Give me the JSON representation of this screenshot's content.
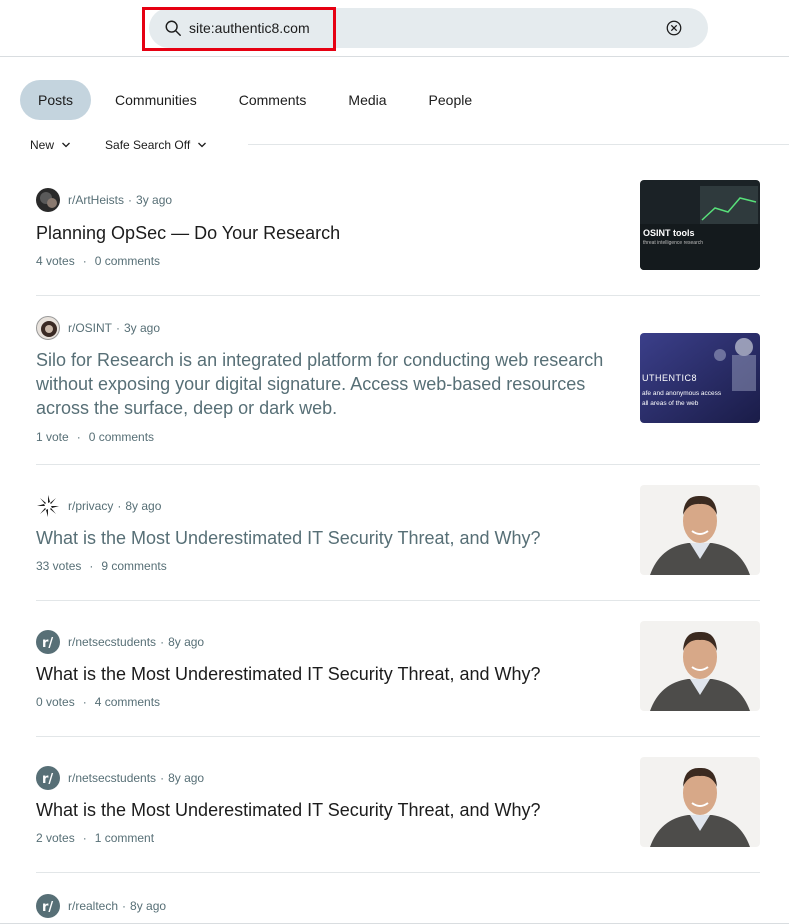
{
  "search": {
    "query": "site:authentic8.com",
    "search_icon": "search-icon",
    "clear_icon": "clear-circle-x-icon",
    "highlight_color": "#e60012"
  },
  "tabs": [
    {
      "label": "Posts",
      "active": true
    },
    {
      "label": "Communities",
      "active": false
    },
    {
      "label": "Comments",
      "active": false
    },
    {
      "label": "Media",
      "active": false
    },
    {
      "label": "People",
      "active": false
    }
  ],
  "filters": {
    "sort_label": "New",
    "safe_search_label": "Safe Search Off"
  },
  "posts": [
    {
      "subreddit": "r/ArtHeists",
      "age": "3y ago",
      "title": "Planning OpSec — Do Your Research",
      "votes": "4 votes",
      "comments": "0 comments",
      "thumb": {
        "text_line1": "OSINT tools",
        "text_line2": "threat intelligence research"
      }
    },
    {
      "subreddit": "r/OSINT",
      "age": "3y ago",
      "title": "Silo for Research is an integrated platform for conducting web research without exposing your digital signature. Access web-based resources across the surface, deep or dark web.",
      "votes": "1 vote",
      "comments": "0 comments",
      "thumb": {
        "text_line1": "UTHENTIC8",
        "text_line2": "afe and anonymous access",
        "text_line3": "all areas of the web"
      }
    },
    {
      "subreddit": "r/privacy",
      "age": "8y ago",
      "title": "What is the Most Underestimated IT Security Threat, and Why?",
      "votes": "33 votes",
      "comments": "9 comments"
    },
    {
      "subreddit": "r/netsecstudents",
      "age": "8y ago",
      "title": "What is the Most Underestimated IT Security Threat, and Why?",
      "votes": "0 votes",
      "comments": "4 comments"
    },
    {
      "subreddit": "r/netsecstudents",
      "age": "8y ago",
      "title": "What is the Most Underestimated IT Security Threat, and Why?",
      "votes": "2 votes",
      "comments": "1 comment"
    },
    {
      "subreddit": "r/realtech",
      "age": "8y ago"
    }
  ],
  "colors": {
    "active_tab": "#c4d4de",
    "search_bg": "#e5ebee",
    "meta_text": "#576f76"
  }
}
